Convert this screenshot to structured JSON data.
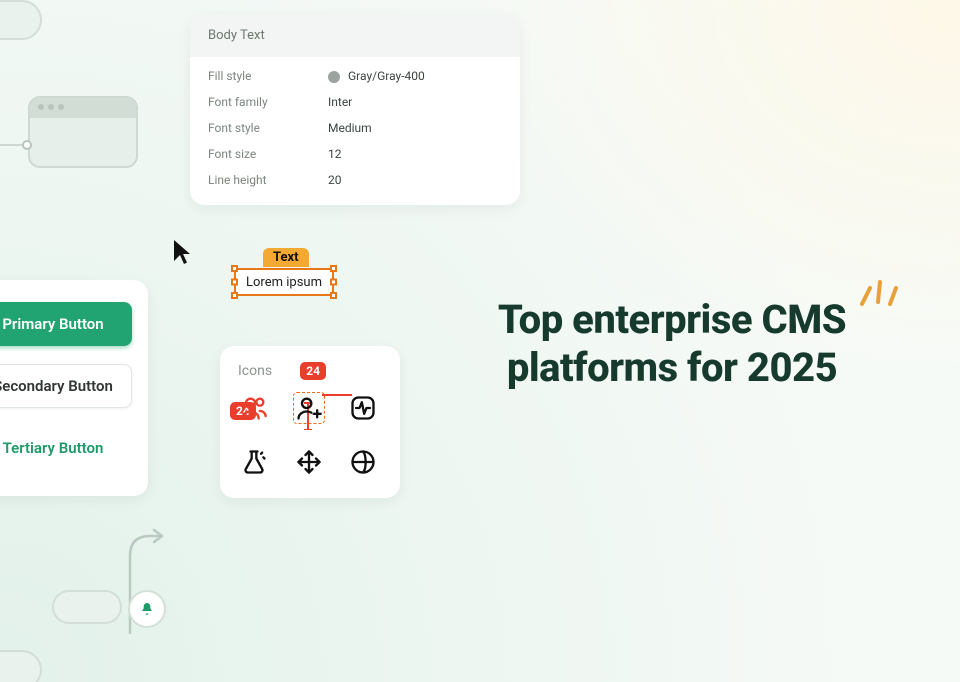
{
  "bodytext": {
    "header": "Body Text",
    "rows": [
      {
        "label": "Fill style",
        "value": "Gray/Gray-400"
      },
      {
        "label": "Font family",
        "value": "Inter"
      },
      {
        "label": "Font style",
        "value": "Medium"
      },
      {
        "label": "Font size",
        "value": "12"
      },
      {
        "label": "Line height",
        "value": "20"
      }
    ]
  },
  "text_selection": {
    "tag": "Text",
    "content": "Lorem ipsum"
  },
  "buttons": {
    "primary": "Primary Button",
    "secondary": "Secondary Button",
    "tertiary": "Tertiary Button"
  },
  "icons_panel": {
    "title": "Icons",
    "dim_badge": "24",
    "dim_badge2": "24"
  },
  "headline": {
    "line1": "Top enterprise CMS",
    "line2": "platforms for 2025"
  }
}
